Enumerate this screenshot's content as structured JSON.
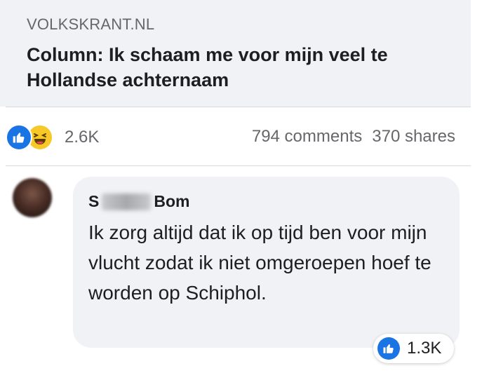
{
  "link": {
    "domain": "VOLKSKRANT.NL",
    "title": "Column: Ik schaam me voor mijn veel te Hollandse achternaam"
  },
  "reactions": {
    "icons": [
      "like-icon",
      "haha-icon"
    ],
    "count": "2.6K"
  },
  "stats": {
    "comments": "794 comments",
    "shares": "370 shares"
  },
  "comment": {
    "author_first": "S",
    "author_last": "Bom",
    "text": "Ik zorg altijd dat ik op tijd ben voor mijn vlucht zodat ik niet omgeroepen hoef te worden op Schiphol.",
    "reaction_icon": "like-icon",
    "reaction_count": "1.3K"
  },
  "colors": {
    "like_blue": "#1b74e4",
    "haha_yellow": "#f7c928",
    "bubble_bg": "#f0f2f5",
    "secondary_text": "#65676b"
  }
}
